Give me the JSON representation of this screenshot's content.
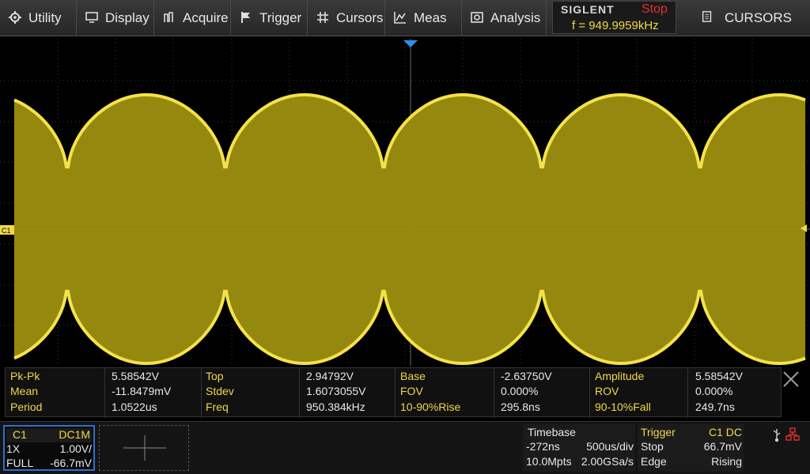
{
  "menu": {
    "items": [
      {
        "label": "Utility",
        "icon": "gear-icon"
      },
      {
        "label": "Display",
        "icon": "monitor-icon"
      },
      {
        "label": "Acquire",
        "icon": "acquire-icon"
      },
      {
        "label": "Trigger",
        "icon": "flag-icon"
      },
      {
        "label": "Cursors",
        "icon": "crosshair-icon"
      },
      {
        "label": "Meas",
        "icon": "meas-icon"
      },
      {
        "label": "Analysis",
        "icon": "analysis-icon"
      }
    ]
  },
  "brand": {
    "name": "SIGLENT",
    "run_state": "Stop",
    "freq": "f = 949.9959kHz"
  },
  "cursors_menu": {
    "label": "CURSORS",
    "icon": "document-icon"
  },
  "channel_marker": "C1",
  "measurements": {
    "rows": [
      [
        [
          "Pk-Pk",
          "5.58542V"
        ],
        [
          "Top",
          "2.94792V"
        ],
        [
          "Base",
          "-2.63750V"
        ],
        [
          "Amplitude",
          "5.58542V"
        ]
      ],
      [
        [
          "Mean",
          "-11.8479mV"
        ],
        [
          "Stdev",
          "1.6073055V"
        ],
        [
          "FOV",
          "0.000%"
        ],
        [
          "ROV",
          "0.000%"
        ]
      ],
      [
        [
          "Period",
          "1.0522us"
        ],
        [
          "Freq",
          "950.384kHz"
        ],
        [
          "10-90%Rise",
          "295.8ns"
        ],
        [
          "90-10%Fall",
          "249.7ns"
        ]
      ]
    ]
  },
  "ch1": {
    "name": "C1",
    "coupling": "DC1M",
    "probe": "1X",
    "scale": "1.00V/",
    "bw": "FULL",
    "offset": "-66.7mV"
  },
  "timebase": {
    "title": "Timebase",
    "delay": "-272ns",
    "scale": "500us/div",
    "depth": "10.0Mpts",
    "rate": "2.00GSa/s"
  },
  "trigger": {
    "title": "Trigger",
    "source": "C1 DC",
    "state": "Stop",
    "level": "66.7mV",
    "type": "Edge",
    "slope": "Rising"
  },
  "colors": {
    "trace": "#d8c51c",
    "label": "#f0d84a",
    "accent_blue": "#2f6fd0",
    "stop_red": "#e03030"
  }
}
